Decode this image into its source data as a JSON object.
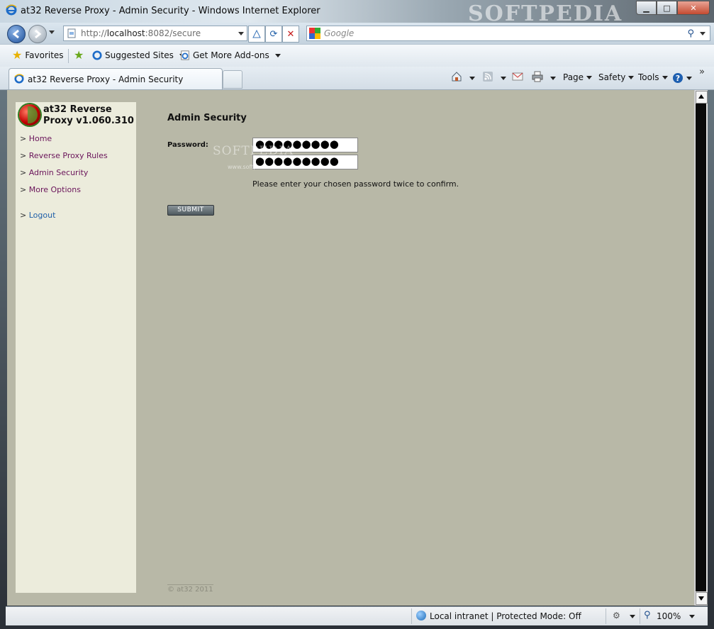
{
  "window": {
    "title": "at32 Reverse Proxy - Admin Security - Windows Internet Explorer",
    "watermark": "SOFTPEDIA",
    "controls": {
      "minimize": "▁",
      "maximize": "□",
      "close": "✕"
    }
  },
  "addressbar": {
    "url_prefix": "http://",
    "url_host": "localhost",
    "url_rest": ":8082/secure",
    "search_placeholder": "Google"
  },
  "favorites_bar": {
    "favorites": "Favorites",
    "suggested_sites": "Suggested Sites",
    "get_more_addons": "Get More Add-ons"
  },
  "tabs": [
    {
      "label": "at32 Reverse Proxy - Admin Security",
      "active": true
    }
  ],
  "command_bar": {
    "page": "Page",
    "safety": "Safety",
    "tools": "Tools",
    "more": "»"
  },
  "page": {
    "brand_line1": "at32 Reverse",
    "brand_line2": "Proxy v1.060.310",
    "nav": [
      {
        "label": "Home"
      },
      {
        "label": "Reverse Proxy Rules"
      },
      {
        "label": "Admin Security"
      },
      {
        "label": "More Options"
      },
      {
        "label": "Logout"
      }
    ],
    "nav_marker": ">",
    "heading": "Admin Security",
    "password_label": "Password:",
    "password_value_1": "●●●●●●●●●",
    "password_value_2": "●●●●●●●●●",
    "hint": "Please enter your chosen password twice to confirm.",
    "submit_label": "SUBMIT",
    "watermark_text": "SOFTPEDIA",
    "watermark_url": "www.softpedia.com",
    "footer": "© at32 2011"
  },
  "statusbar": {
    "zone": "Local intranet | Protected Mode: Off",
    "zoom": "100%"
  }
}
